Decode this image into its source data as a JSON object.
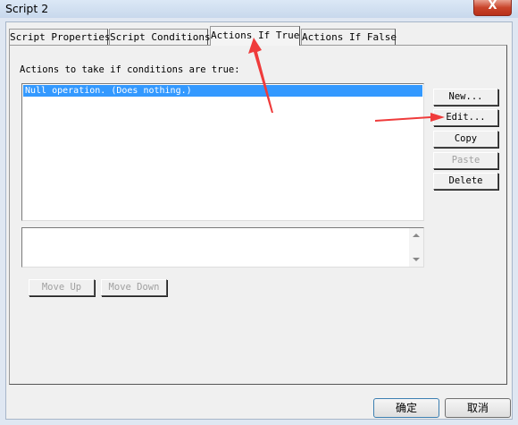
{
  "window": {
    "title": "Script 2",
    "close_glyph": "X"
  },
  "tabs": [
    {
      "label": "Script Properties",
      "active": false
    },
    {
      "label": "Script Conditions",
      "active": false
    },
    {
      "label": "Actions If True",
      "active": true
    },
    {
      "label": "Actions If False",
      "active": false
    }
  ],
  "panel": {
    "actions_label": "Actions to take if conditions are true:",
    "actions_list": [
      "Null operation. (Does nothing.)"
    ]
  },
  "side_buttons": {
    "new": "New...",
    "edit": "Edit...",
    "copy": "Copy",
    "paste": "Paste",
    "delete": "Delete"
  },
  "move_buttons": {
    "up": "Move Up",
    "down": "Move Down"
  },
  "dialog_buttons": {
    "ok": "确定",
    "cancel": "取消"
  },
  "colors": {
    "selection": "#3399ff",
    "annotation_arrow": "#ef3b3b"
  },
  "icons": {
    "close": "close-icon",
    "scroll_up": "scroll-up-arrow-icon",
    "scroll_down": "scroll-down-arrow-icon"
  }
}
